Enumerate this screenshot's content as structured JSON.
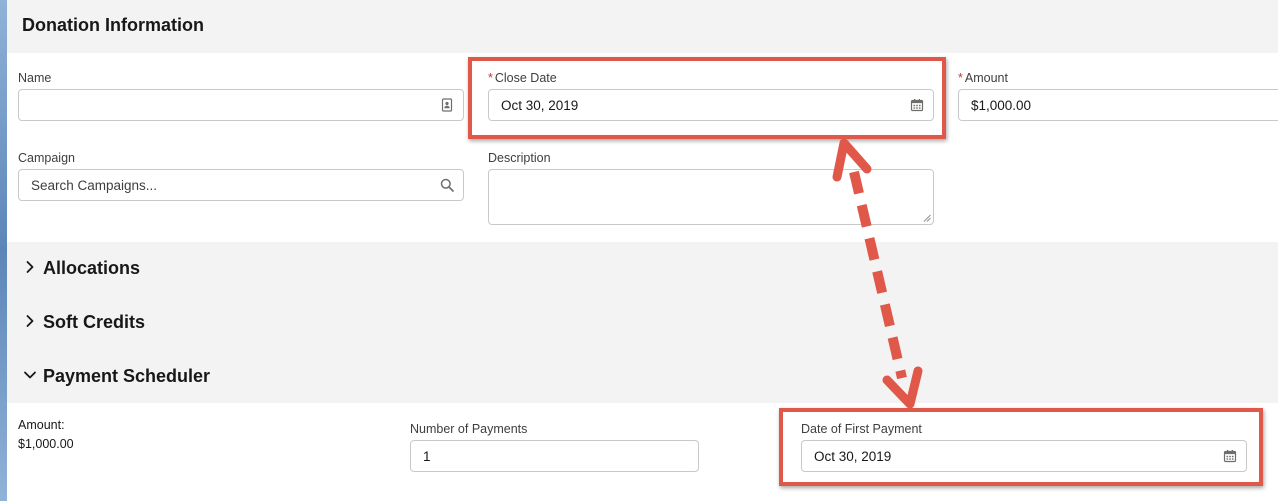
{
  "sections": {
    "donation_information": "Donation Information",
    "allocations": "Allocations",
    "soft_credits": "Soft Credits",
    "payment_scheduler": "Payment Scheduler"
  },
  "fields": {
    "name": {
      "label": "Name",
      "value": ""
    },
    "close_date": {
      "required": "*",
      "label": "Close Date",
      "value": "Oct 30, 2019"
    },
    "amount": {
      "required": "*",
      "label": "Amount",
      "value": "$1,000.00"
    },
    "campaign": {
      "label": "Campaign",
      "placeholder": "Search Campaigns..."
    },
    "description": {
      "label": "Description",
      "value": ""
    }
  },
  "payment_scheduler": {
    "amount_label": "Amount:",
    "amount_value": "$1,000.00",
    "number_of_payments": {
      "label": "Number of Payments",
      "value": "1"
    },
    "date_of_first_payment": {
      "label": "Date of First Payment",
      "value": "Oct 30, 2019"
    }
  },
  "icons": {
    "name_field": "contact-card-icon",
    "date": "calendar-icon",
    "search": "search-icon",
    "collapsed": "chevron-right-icon",
    "expanded": "chevron-down-icon"
  },
  "colors": {
    "highlight": "#e0584a",
    "required": "#c23934",
    "section_bg": "#f3f3f3"
  }
}
